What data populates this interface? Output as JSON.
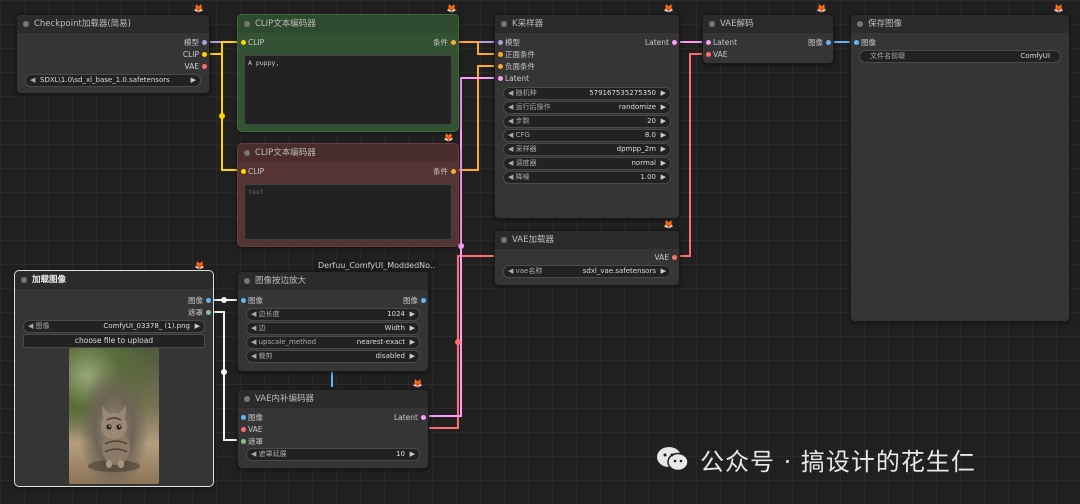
{
  "watermark": {
    "text": "公众号 · 搞设计的花生仁"
  },
  "group_label": "Derfuu_ComfyUI_ModdedNo..",
  "badge_icon": "fox-icon",
  "nodes": {
    "checkpoint": {
      "title": "Checkpoint加载器(简易)",
      "outputs": [
        "模型",
        "CLIP",
        "VAE"
      ],
      "widget": {
        "value": "SDXL\\1.0\\sd_xl_base_1.0.safetensors"
      }
    },
    "clip_pos": {
      "title": "CLIP文本编码器",
      "input": "CLIP",
      "output": "条件",
      "text": "A puppy,"
    },
    "clip_neg": {
      "title": "CLIP文本编码器",
      "input": "CLIP",
      "output": "条件",
      "placeholder": "text"
    },
    "ksampler": {
      "title": "K采样器",
      "inputs": [
        "模型",
        "正面条件",
        "负面条件",
        "Latent"
      ],
      "output": "Latent",
      "widgets": [
        {
          "label": "随机种",
          "value": "579167535275350"
        },
        {
          "label": "运行后操作",
          "value": "randomize"
        },
        {
          "label": "步数",
          "value": "20"
        },
        {
          "label": "CFG",
          "value": "8.0"
        },
        {
          "label": "采样器",
          "value": "dpmpp_2m"
        },
        {
          "label": "调度器",
          "value": "normal"
        },
        {
          "label": "降噪",
          "value": "1.00"
        }
      ]
    },
    "vae_decode": {
      "title": "VAE解码",
      "inputs": [
        "Latent",
        "VAE"
      ],
      "output": "图像"
    },
    "save": {
      "title": "保存图像",
      "input": "图像",
      "widget": {
        "label": "文件名前缀",
        "value": "ComfyUI"
      }
    },
    "vae_loader": {
      "title": "VAE加载器",
      "output": "VAE",
      "widget": {
        "label": "vae名称",
        "value": "sdxl_vae.safetensors"
      }
    },
    "load_image": {
      "title": "加载图像",
      "outputs": [
        "图像",
        "遮罩"
      ],
      "widget": {
        "label": "图像",
        "value": "ComfyUI_03378_ (1).png"
      },
      "upload": "choose file to upload"
    },
    "upscale": {
      "title": "图像按边放大",
      "input": "图像",
      "output": "图像",
      "widgets": [
        {
          "label": "边长度",
          "value": "1024"
        },
        {
          "label": "边",
          "value": "Width"
        },
        {
          "label": "upscale_method",
          "value": "nearest-exact"
        },
        {
          "label": "裁剪",
          "value": "disabled"
        }
      ]
    },
    "inpaint": {
      "title": "VAE内补编码器",
      "inputs": [
        "图像",
        "VAE",
        "遮罩"
      ],
      "output": "Latent",
      "widget": {
        "label": "遮罩延展",
        "value": "10"
      }
    }
  },
  "colors": {
    "model": "#b39ddb",
    "clip": "#ffd500",
    "vae": "#ff6e6e",
    "cond": "#ffa931",
    "latent": "#ff9cf9",
    "image": "#64b5f6",
    "mask": "#81c784"
  }
}
